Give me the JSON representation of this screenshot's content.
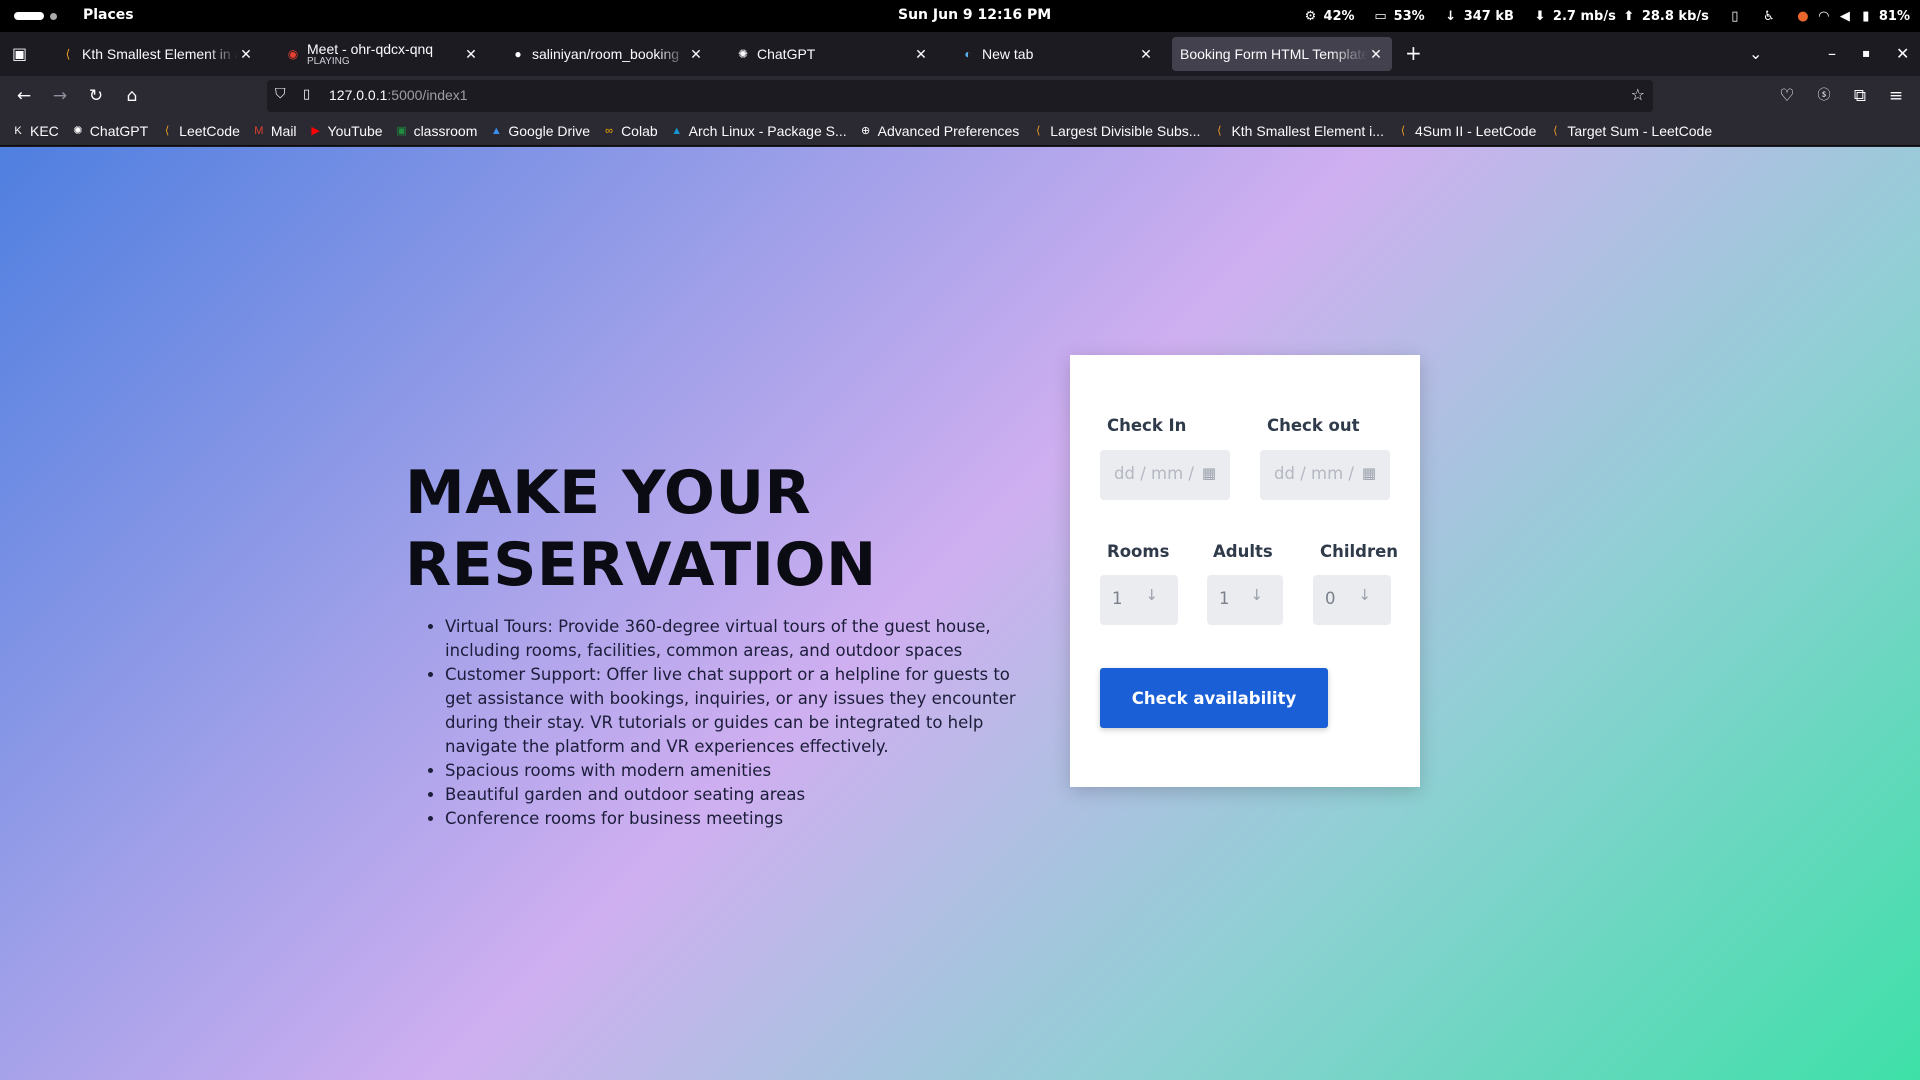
{
  "topbar": {
    "places": "Places",
    "clock": "Sun Jun 9  12:16 PM",
    "cpu": "42%",
    "memory": "53%",
    "disk": "347 kB",
    "net_down": "2.7 mb/s",
    "net_up": "28.8 kb/s",
    "battery": "81%"
  },
  "tabs": [
    {
      "title": "Kth Smallest Element in a",
      "subtitle": "",
      "icon": "leetcode-icon"
    },
    {
      "title": "Meet - ohr-qdcx-qnq",
      "subtitle": "PLAYING",
      "icon": "meet-icon"
    },
    {
      "title": "saliniyan/room_booking",
      "subtitle": "",
      "icon": "github-icon"
    },
    {
      "title": "ChatGPT",
      "subtitle": "",
      "icon": "chatgpt-icon"
    },
    {
      "title": "New tab",
      "subtitle": "",
      "icon": "firefox-icon"
    },
    {
      "title": "Booking Form HTML Template",
      "subtitle": "",
      "icon": "page-icon",
      "active": true
    }
  ],
  "url": {
    "host": "127.0.0.1",
    "path": ":5000/index1"
  },
  "bookmarks": [
    {
      "label": "KEC",
      "icon": "kec-icon",
      "color": "#ffffff"
    },
    {
      "label": "ChatGPT",
      "icon": "chatgpt-icon",
      "color": "#ffffff"
    },
    {
      "label": "LeetCode",
      "icon": "leetcode-icon",
      "color": "#f0a020"
    },
    {
      "label": "Mail",
      "icon": "gmail-icon",
      "color": "#e04030"
    },
    {
      "label": "YouTube",
      "icon": "youtube-icon",
      "color": "#ff0000"
    },
    {
      "label": "classroom",
      "icon": "classroom-icon",
      "color": "#1e8e3e"
    },
    {
      "label": "Google Drive",
      "icon": "drive-icon",
      "color": "#3a8ff0"
    },
    {
      "label": "Colab",
      "icon": "colab-icon",
      "color": "#f9ab00"
    },
    {
      "label": "Arch Linux - Package S...",
      "icon": "arch-icon",
      "color": "#1793d1"
    },
    {
      "label": "Advanced Preferences",
      "icon": "globe-icon",
      "color": "#ffffff"
    },
    {
      "label": "Largest Divisible Subs...",
      "icon": "leetcode-icon",
      "color": "#f0a020"
    },
    {
      "label": "Kth Smallest Element i...",
      "icon": "leetcode-icon",
      "color": "#f0a020"
    },
    {
      "label": "4Sum II - LeetCode",
      "icon": "leetcode-icon",
      "color": "#f0a020"
    },
    {
      "label": "Target Sum - LeetCode",
      "icon": "leetcode-icon",
      "color": "#f0a020"
    }
  ],
  "hero": {
    "heading_line1": "MAKE YOUR",
    "heading_line2": "RESERVATION",
    "features": [
      "Virtual Tours: Provide 360-degree virtual tours of the guest house, including rooms, facilities, common areas, and outdoor spaces",
      "Customer Support: Offer live chat support or a helpline for guests to get assistance with bookings, inquiries, or any issues they encounter during their stay. VR tutorials or guides can be integrated to help navigate the platform and VR experiences effectively.",
      "Spacious rooms with modern amenities",
      "Beautiful garden and outdoor seating areas",
      "Conference rooms for business meetings"
    ]
  },
  "form": {
    "check_in_label": "Check In",
    "check_out_label": "Check out",
    "date_placeholder": "dd / mm /",
    "rooms_label": "Rooms",
    "adults_label": "Adults",
    "children_label": "Children",
    "rooms_value": "1",
    "adults_value": "1",
    "children_value": "0",
    "submit_label": "Check availability"
  },
  "colors": {
    "accent": "#1b5fd6",
    "card": "#ffffff"
  }
}
